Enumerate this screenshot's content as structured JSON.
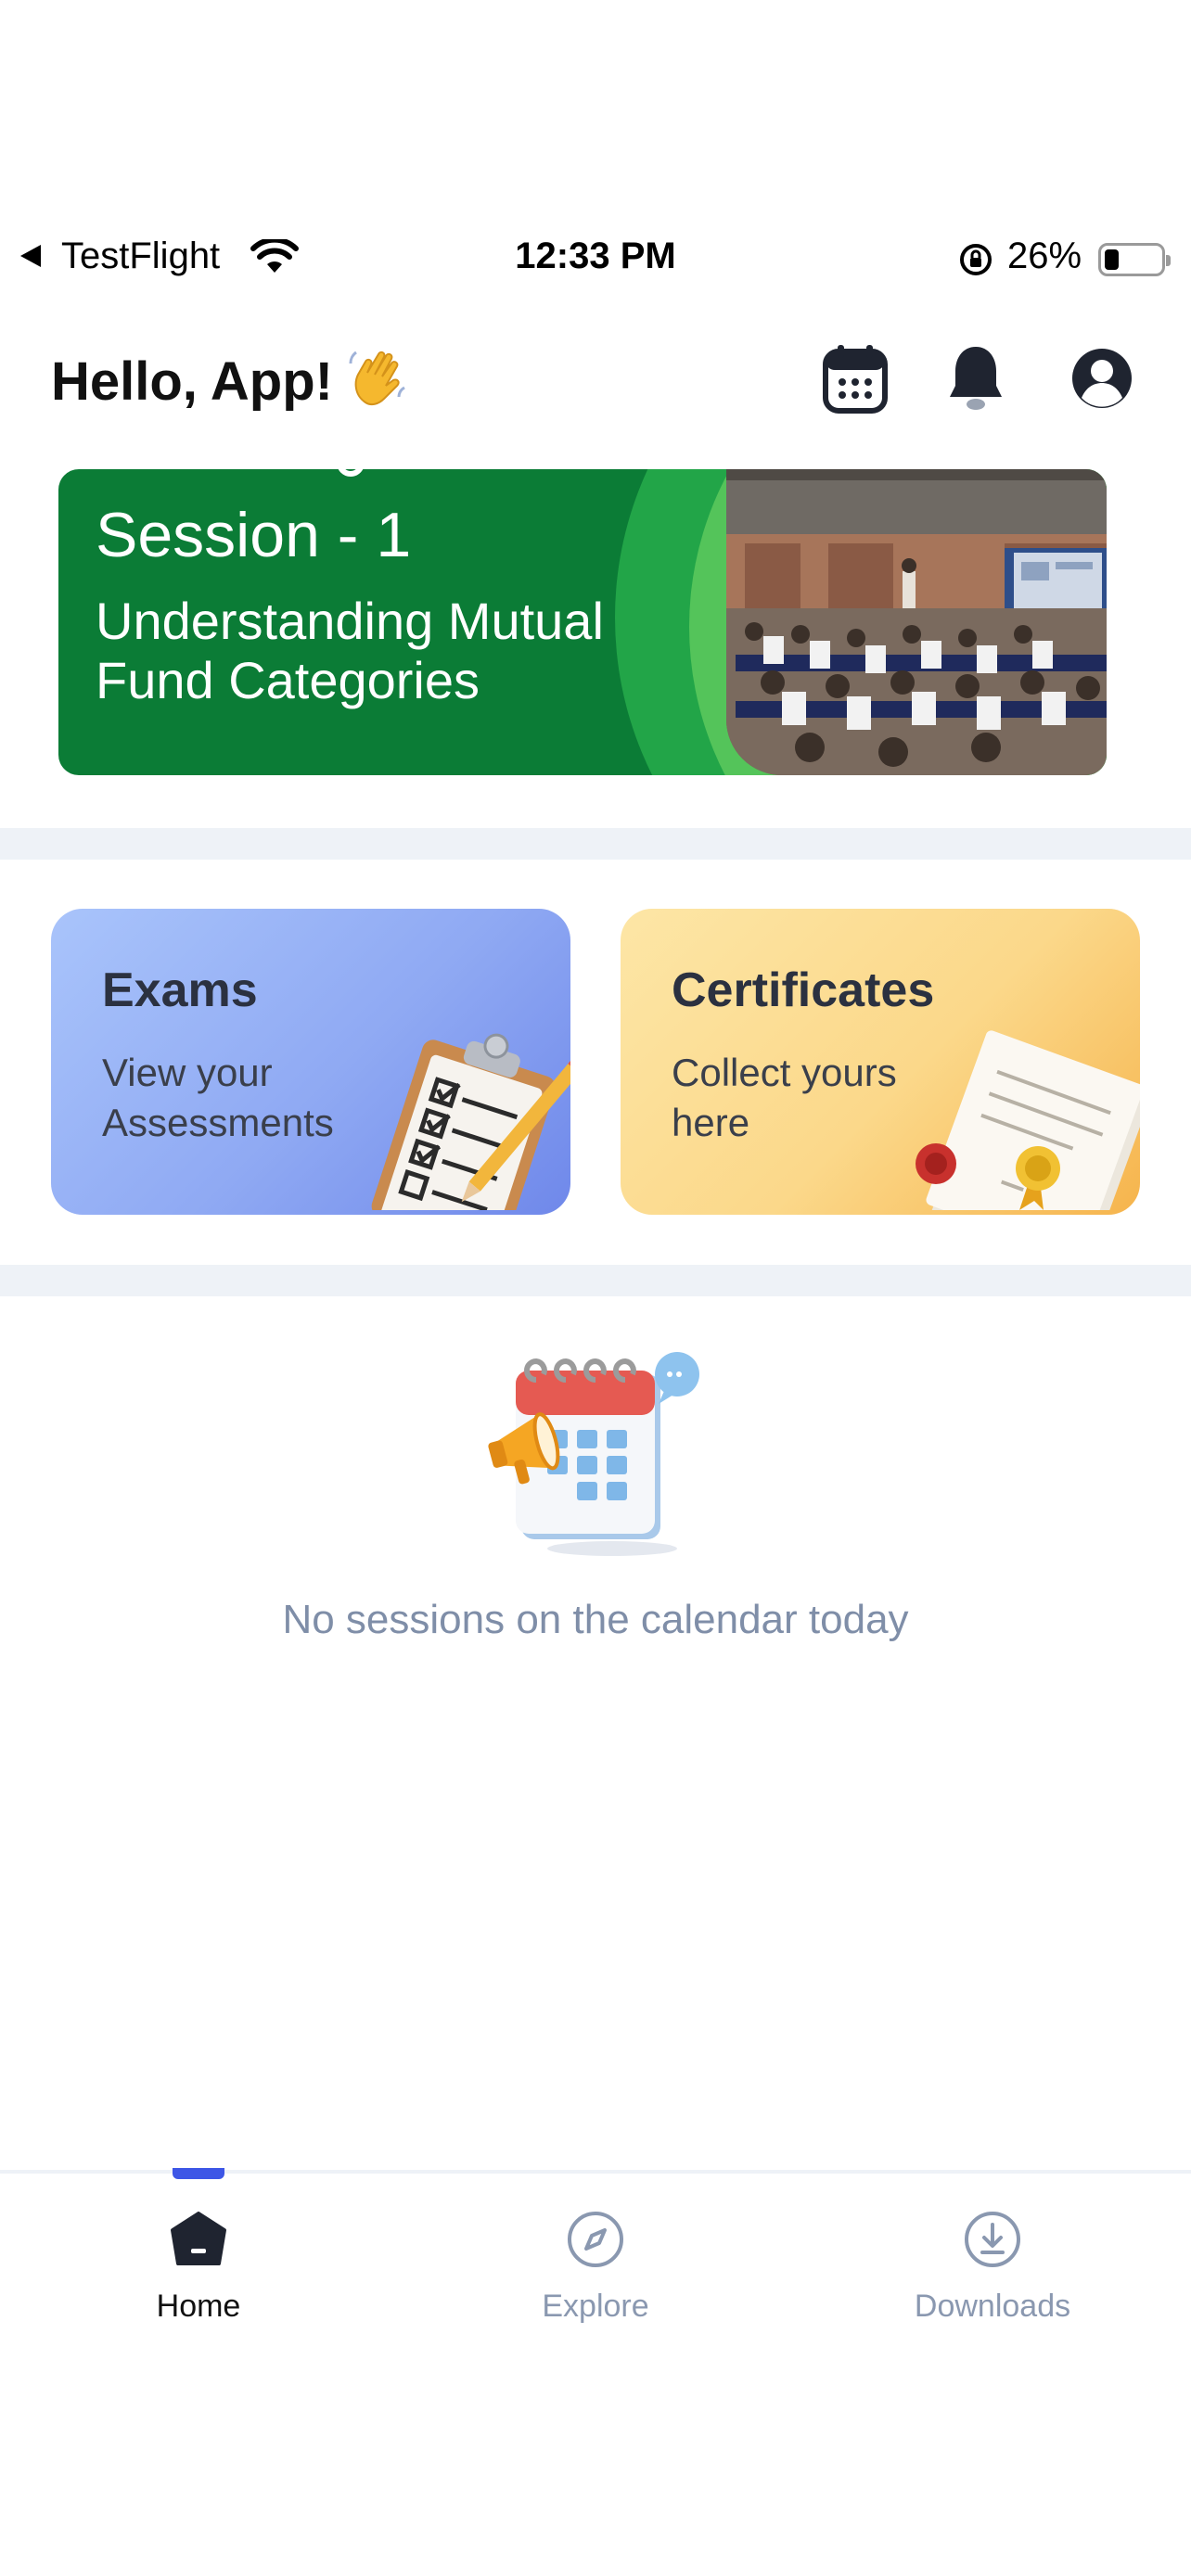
{
  "status_bar": {
    "back_app": "TestFlight",
    "time": "12:33 PM",
    "battery_percent": "26%",
    "battery_level": 0.26
  },
  "header": {
    "greeting": "Hello, App!",
    "icons": [
      "calendar-icon",
      "bell-icon",
      "profile-icon"
    ]
  },
  "banner": {
    "title": "Session - 1",
    "subtitle": "Understanding Mutual Fund Categories"
  },
  "cards": {
    "exams": {
      "title": "Exams",
      "subtitle": "View your Assessments"
    },
    "certificates": {
      "title": "Certificates",
      "subtitle": "Collect yours here"
    }
  },
  "empty_state": {
    "message": "No sessions on the calendar today"
  },
  "bottom_nav": {
    "items": [
      {
        "label": "Home",
        "icon": "home-icon",
        "active": true
      },
      {
        "label": "Explore",
        "icon": "compass-icon",
        "active": false
      },
      {
        "label": "Downloads",
        "icon": "download-icon",
        "active": false
      }
    ]
  },
  "colors": {
    "accent": "#3d56e6",
    "banner_green": "#0b7c36",
    "muted_text": "#7f8ea8",
    "divider": "#eef2f7"
  }
}
